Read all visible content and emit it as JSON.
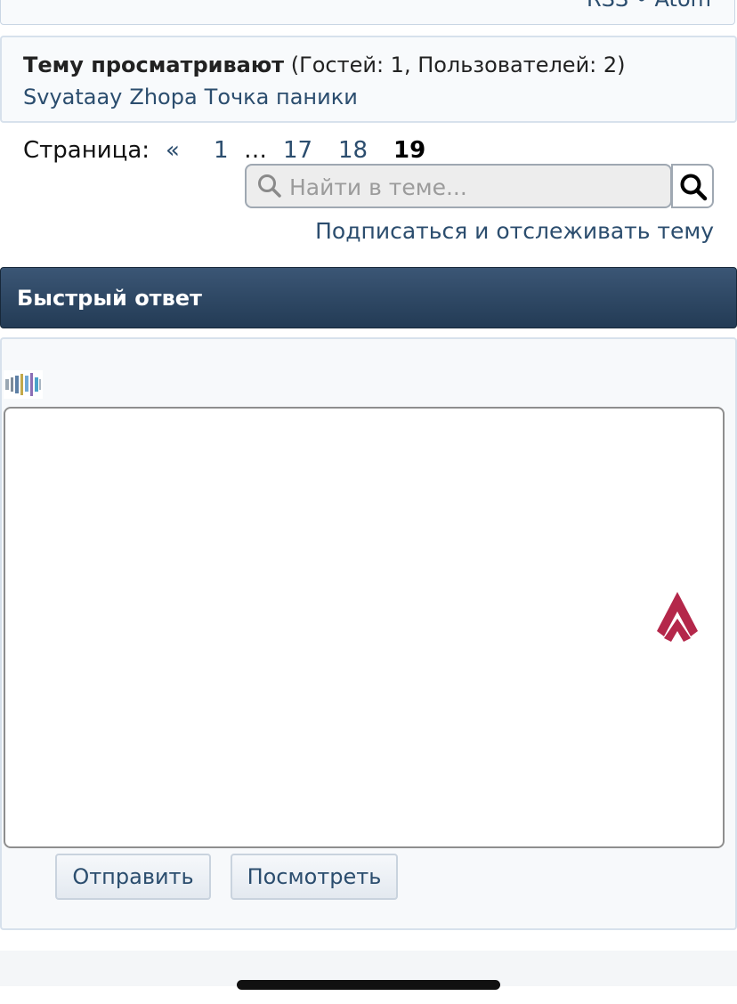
{
  "feeds": {
    "rss": "RSS",
    "separator": "•",
    "atom": "Atom"
  },
  "viewers": {
    "title": "Тему просматривают",
    "counts": "(Гостей: 1, Пользователей: 2)",
    "users": [
      "Svyataay",
      "Zhopa",
      "Точка паники"
    ]
  },
  "pagination": {
    "label": "Страница:",
    "prev": "«",
    "pages": [
      "1",
      "…",
      "17",
      "18"
    ],
    "current": "19"
  },
  "search": {
    "placeholder": "Найти в теме..."
  },
  "subscribe": {
    "label": "Подписаться и отслеживать тему"
  },
  "quick_reply": {
    "title": "Быстрый ответ",
    "submit_label": "Отправить",
    "preview_label": "Посмотреть"
  },
  "colors": {
    "link": "#2b4d6e",
    "header_bg": "#2e4866",
    "scroll_top_icon": "#b4274a"
  },
  "icons": {
    "search": "magnifier-icon",
    "scroll_top": "scroll-to-top-icon",
    "captcha": "captcha-image"
  }
}
